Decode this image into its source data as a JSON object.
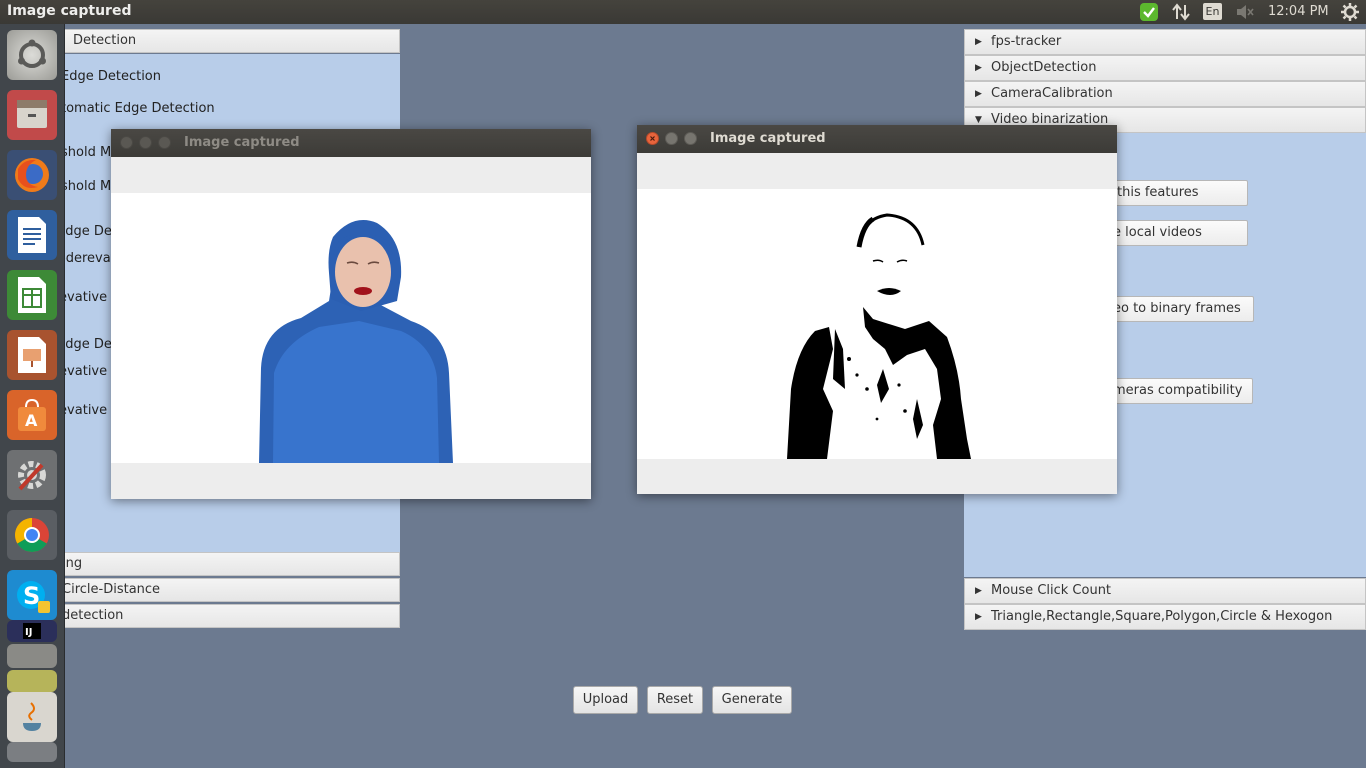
{
  "topbar": {
    "window_title": "Image captured",
    "lang": "En",
    "clock": "12:04 PM"
  },
  "left_panel": {
    "header": "Detection",
    "items": [
      "Edge Detection",
      "tomatic Edge Detection",
      "shold Min",
      "shold Max",
      "Edge De",
      "-derevative",
      "revative",
      "Edge De",
      "revative",
      "revative"
    ],
    "footer_items": [
      "ing",
      "Circle-Distance",
      "detection"
    ]
  },
  "right_panel": {
    "sections": [
      "fps-tracker",
      "ObjectDetection",
      "CameraCalibration",
      "Video binarization"
    ],
    "buttons": [
      "this features",
      "e local videos",
      "eo to binary frames",
      "meras compatibility"
    ],
    "footer_sections": [
      "Mouse Click Count",
      "Triangle,Rectangle,Square,Polygon,Circle & Hexogon"
    ]
  },
  "windows": [
    {
      "title": "Image captured",
      "active": false
    },
    {
      "title": "Image captured",
      "active": true
    }
  ],
  "bottom_buttons": {
    "upload": "Upload",
    "reset": "Reset",
    "generate": "Generate"
  },
  "launcher": [
    "ubuntu-dash-icon",
    "files-icon",
    "firefox-icon",
    "writer-icon",
    "calc-icon",
    "impress-icon",
    "software-center-icon",
    "settings-icon",
    "chrome-icon",
    "skype-icon",
    "intellij-icon",
    "java-icon"
  ],
  "colors": {
    "panel_blue": "#b8cde9",
    "desktop": "#6c7a90",
    "close_orange": "#e8643c"
  }
}
